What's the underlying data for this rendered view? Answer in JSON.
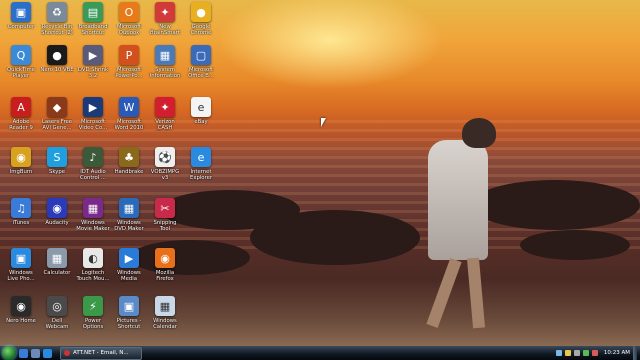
{
  "desktop": {
    "icons": [
      {
        "label": "Computer",
        "color": "#2a6fc9",
        "glyph": "▣"
      },
      {
        "label": "Recycle Bin Shortcut (2)",
        "color": "#7a8a9a",
        "glyph": "♻"
      },
      {
        "label": "Broadband Shortcut",
        "color": "#3a9a5a",
        "glyph": "▤"
      },
      {
        "label": "Microsoft Outlook 2010",
        "color": "#e87a1a",
        "glyph": "O"
      },
      {
        "label": "New BrainSmart",
        "color": "#d23a3a",
        "glyph": "✦"
      },
      {
        "label": "Google Chrome",
        "color": "#e8b020",
        "glyph": "●"
      },
      {
        "label": "QuickTime Player",
        "color": "#3a8ad8",
        "glyph": "Q"
      },
      {
        "label": "Nero 10 VBE",
        "color": "#1a1a1a",
        "glyph": "●"
      },
      {
        "label": "DVD Shrink 3.2",
        "color": "#5a5a7a",
        "glyph": "▶"
      },
      {
        "label": "Microsoft PowerPo...",
        "color": "#d2501e",
        "glyph": "P"
      },
      {
        "label": "System Information",
        "color": "#4a7ab8",
        "glyph": "▦"
      },
      {
        "label": "Microsoft Office B...",
        "color": "#3a6ab8",
        "glyph": "▢"
      },
      {
        "label": "Adobe Reader 9",
        "color": "#c81e1e",
        "glyph": "A"
      },
      {
        "label": "Lasers Free AVI Gene...",
        "color": "#8a3a1a",
        "glyph": "◆"
      },
      {
        "label": "Microsoft Video Co...",
        "color": "#1a3a7a",
        "glyph": "▶"
      },
      {
        "label": "Microsoft Word 2010",
        "color": "#2a5ab8",
        "glyph": "W"
      },
      {
        "label": "Verizon CASH Master",
        "color": "#d21e2e",
        "glyph": "✦"
      },
      {
        "label": "eBay",
        "color": "#f4f4f4",
        "glyph": "e"
      },
      {
        "label": "ImgBurn",
        "color": "#d8a21e",
        "glyph": "◉"
      },
      {
        "label": "Skype",
        "color": "#1ea0e0",
        "glyph": "S"
      },
      {
        "label": "IDT Audio Control ...",
        "color": "#3a5a3a",
        "glyph": "♪"
      },
      {
        "label": "Handbrake",
        "color": "#8a6a1a",
        "glyph": "♣"
      },
      {
        "label": "VOBZIMPG v3",
        "color": "#eeeeee",
        "glyph": "⚽"
      },
      {
        "label": "Internet Explorer",
        "color": "#2a8ae0",
        "glyph": "e"
      },
      {
        "label": "iTunes",
        "color": "#3a7ad8",
        "glyph": "♫"
      },
      {
        "label": "Audacity",
        "color": "#2a3ab8",
        "glyph": "◉"
      },
      {
        "label": "Windows Movie Maker",
        "color": "#7a2a8a",
        "glyph": "▦"
      },
      {
        "label": "Windows DVD Maker",
        "color": "#2a6ab8",
        "glyph": "▦"
      },
      {
        "label": "Snipping Tool",
        "color": "#c82a4a",
        "glyph": "✂"
      },
      {
        "label": "Windows Live Pho...",
        "color": "#2a8ae0",
        "glyph": "▣"
      },
      {
        "label": "Calculator",
        "color": "#8a9aaa",
        "glyph": "▦"
      },
      {
        "label": "Logitech Touch Mou...",
        "color": "#e8e8e8",
        "glyph": "◐"
      },
      {
        "label": "Windows Media Player",
        "color": "#2a7ad8",
        "glyph": "▶"
      },
      {
        "label": "Mozilla Firefox",
        "color": "#e8701a",
        "glyph": "◉"
      },
      {
        "label": "Nero Home",
        "color": "#2a2a2a",
        "glyph": "◉"
      },
      {
        "label": "Dell Webcam Central",
        "color": "#4a4a4a",
        "glyph": "◎"
      },
      {
        "label": "Power Options",
        "color": "#3a9a4a",
        "glyph": "⚡"
      },
      {
        "label": "Pictures - Shortcut",
        "color": "#5a8ac8",
        "glyph": "▣"
      },
      {
        "label": "Windows Calendar",
        "color": "#c8d8e8",
        "glyph": "▦"
      }
    ]
  },
  "taskbar": {
    "task_label": "ATT.NET - Email, N...",
    "clock": "10:23 AM"
  }
}
